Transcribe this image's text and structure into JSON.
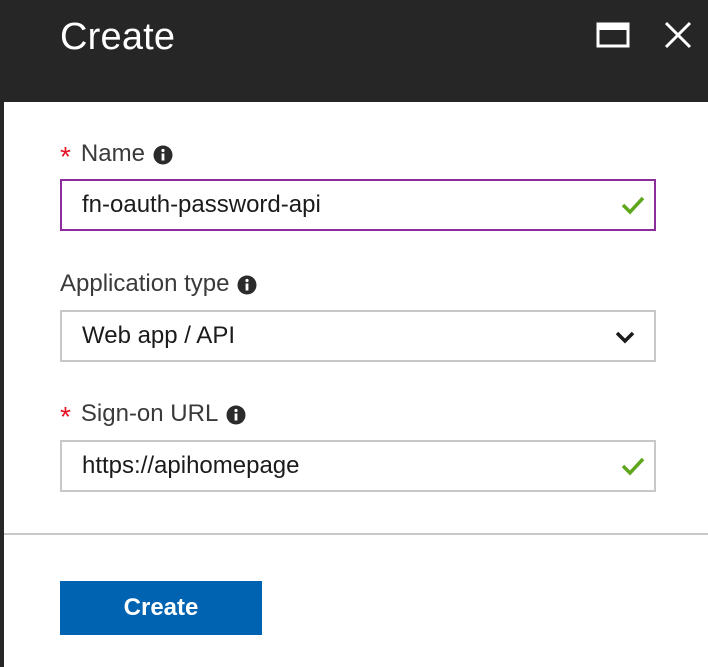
{
  "header": {
    "title": "Create",
    "maximize_icon": "maximize-icon",
    "close_icon": "close-icon"
  },
  "form": {
    "name": {
      "required_mark": "*",
      "label": "Name",
      "value": "fn-oauth-password-api",
      "valid": true
    },
    "app_type": {
      "label": "Application type",
      "selected": "Web app / API"
    },
    "sign_on_url": {
      "required_mark": "*",
      "label": "Sign-on URL",
      "value": "https://apihomepage",
      "valid": true
    }
  },
  "footer": {
    "create_label": "Create"
  },
  "colors": {
    "header_bg": "#262626",
    "required": "#e81123",
    "focus_border": "#8b2e9c",
    "valid_check": "#5ea71c",
    "primary_button": "#0063b1"
  }
}
